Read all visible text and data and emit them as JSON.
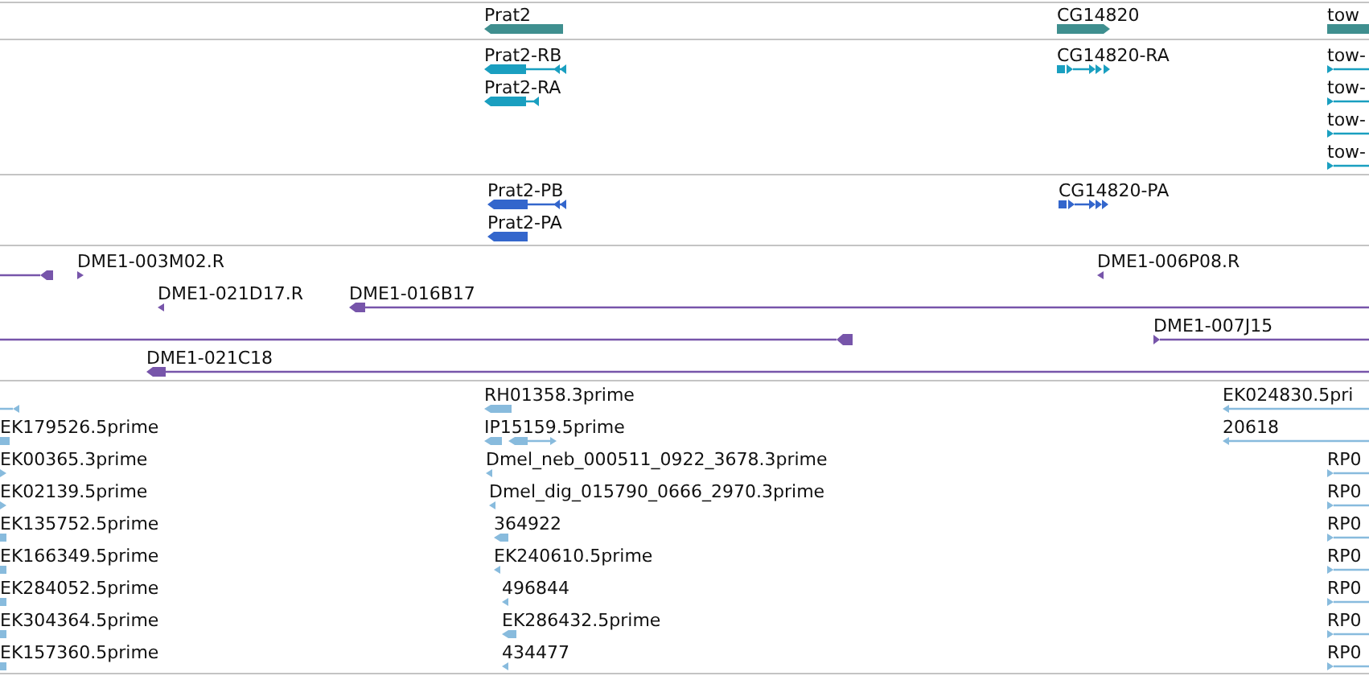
{
  "tracks": [
    {
      "color": "#3f8f8f",
      "features": [
        {
          "label": "Prat2"
        },
        {
          "label": "CG14820"
        },
        {
          "label": "tow"
        }
      ]
    },
    {
      "color": "#1a9fc0",
      "features": [
        {
          "label": "Prat2-RB"
        },
        {
          "label": "Prat2-RA"
        },
        {
          "label": "CG14820-RA"
        },
        {
          "label": "tow-"
        },
        {
          "label": "tow-"
        },
        {
          "label": "tow-"
        },
        {
          "label": "tow-"
        }
      ]
    },
    {
      "color": "#3366cc",
      "features": [
        {
          "label": "Prat2-PB"
        },
        {
          "label": "Prat2-PA"
        },
        {
          "label": "CG14820-PA"
        }
      ]
    },
    {
      "color": "#7755aa",
      "features": [
        {
          "label": "DME1-003M02.R"
        },
        {
          "label": "DME1-021D17.R"
        },
        {
          "label": "DME1-016B17"
        },
        {
          "label": "DME1-006P08.R"
        },
        {
          "label": "DME1-007J15"
        },
        {
          "label": "DME1-021C18"
        }
      ]
    },
    {
      "color": "#88bbdd",
      "features": [
        {
          "label": "EK179526.5prime"
        },
        {
          "label": "EK00365.3prime"
        },
        {
          "label": "EK02139.5prime"
        },
        {
          "label": "EK135752.5prime"
        },
        {
          "label": "EK166349.5prime"
        },
        {
          "label": "EK284052.5prime"
        },
        {
          "label": "EK304364.5prime"
        },
        {
          "label": "EK157360.5prime"
        },
        {
          "label": "RH01358.3prime"
        },
        {
          "label": "IP15159.5prime"
        },
        {
          "label": "Dmel_neb_000511_0922_3678.3prime"
        },
        {
          "label": "Dmel_dig_015790_0666_2970.3prime"
        },
        {
          "label": "364922"
        },
        {
          "label": "EK240610.5prime"
        },
        {
          "label": "496844"
        },
        {
          "label": "EK286432.5prime"
        },
        {
          "label": "434477"
        },
        {
          "label": "EK024830.5pri"
        },
        {
          "label": "20618"
        },
        {
          "label": "RP0"
        },
        {
          "label": "RP0"
        },
        {
          "label": "RP0"
        },
        {
          "label": "RP0"
        },
        {
          "label": "RP0"
        },
        {
          "label": "RP0"
        },
        {
          "label": "RP0"
        }
      ]
    }
  ]
}
